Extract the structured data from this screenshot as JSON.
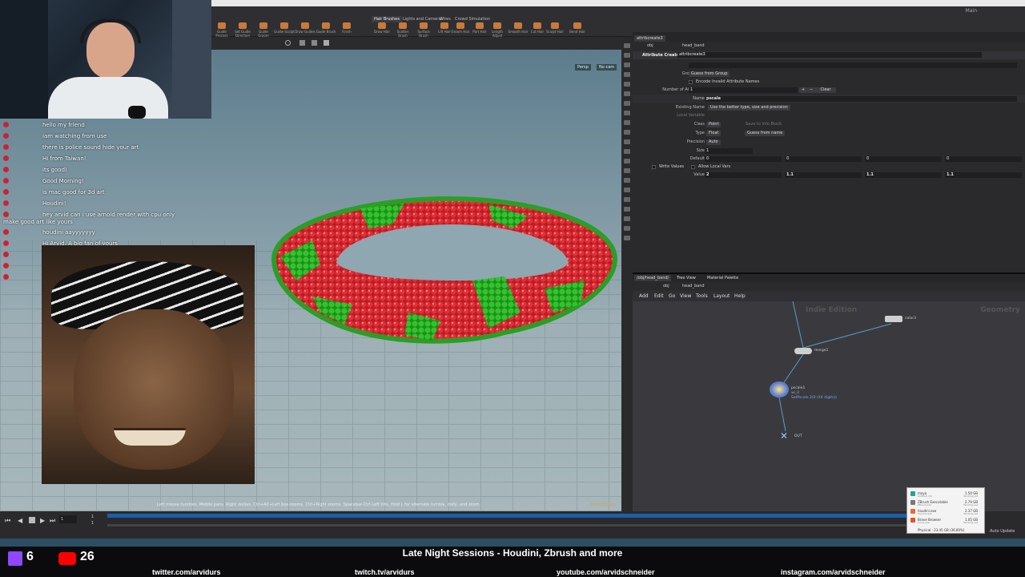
{
  "shelf": {
    "tabs": [
      "Hair Brushes",
      "Lights and Cameras",
      "Wires",
      "Crowd Simulation"
    ],
    "tools": [
      "Guide Process",
      "Set Guide Direction",
      "Guide Groom",
      "Guide Sculpt",
      "Draw Guides",
      "Guide Brush",
      "Finish",
      "Draw Hair",
      "Scatter Brush",
      "Surface Brush",
      "Lift Hair",
      "Groom Hair",
      "Part Hair",
      "Length Adjust",
      "Smooth Hair",
      "Cut Hair",
      "Sculpt Hair",
      "Bend Hair"
    ],
    "workspace": "Main"
  },
  "viewport": {
    "persp": "Persp",
    "cam": "No cam",
    "hint": "Left mouse tumbles. Middle pans. Right dollies. Ctrl+Alt+Left box-zooms. Ctrl+Right zooms. Spacebar-Ctrl-Left tilts. Hold L for alternate tumble, dolly, and zoom.",
    "indie": "Indie Edition"
  },
  "chat": [
    {
      "user": "",
      "msg": "hello my friend"
    },
    {
      "user": "",
      "msg": "iam watching from use"
    },
    {
      "user": "",
      "msg": "there is police sound hide your art"
    },
    {
      "user": "",
      "msg": "Hi from Taiwan!"
    },
    {
      "user": "",
      "msg": "its good)"
    },
    {
      "user": "",
      "msg": "Good Morning!"
    },
    {
      "user": "",
      "msg": "is mac good for 3d art"
    },
    {
      "user": "",
      "msg": "Houdini!"
    },
    {
      "user": "",
      "msg": "hey arvid can i use arnold render with cpu only"
    },
    {
      "user": "",
      "msg": "make good art like yours"
    },
    {
      "user": "",
      "msg": "houdini aayyyyyyy"
    },
    {
      "user": "",
      "msg": "Hi Arvid. A big fan of yours"
    },
    {
      "user": "",
      "msg": "do you ever sleep"
    },
    {
      "user": "",
      "msg": "Ohhh look who it is!"
    },
    {
      "user": "",
      "msg": "The chat is ready to display messages..."
    }
  ],
  "params": {
    "tab": "attribcreate3",
    "path_node": "head_band",
    "path_obj": "obj",
    "node_type": "Attribute Create",
    "node_name": "attribcreate3",
    "group_label": "Group",
    "group_type_label": "Group Type",
    "group_type": "Guess from Group",
    "encode_label": "Encode Invalid Attribute Names",
    "num_attrs_label": "Number of Attributes",
    "num_attrs": "1",
    "clear": "Clear",
    "name_label": "Name",
    "name_value": "pscale",
    "existing_label": "Existing Name",
    "existing_value": "Use the better type, size and precision",
    "local_var_label": "Local Variable",
    "class_label": "Class",
    "class_value": "Point",
    "save_info": "Save to Info Block",
    "type_label": "Type",
    "type_value": "Float",
    "guess_name": "Guess from name",
    "precision_label": "Precision",
    "precision_value": "Auto",
    "size_label": "Size",
    "size_value": "1",
    "default_label": "Default",
    "default_values": [
      "0",
      "0",
      "0",
      "0"
    ],
    "write_label": "Write Values",
    "allow_local": "Allow Local Vars",
    "value_label": "Value",
    "values": [
      "2",
      "1.1",
      "1.1",
      "1.1"
    ]
  },
  "network": {
    "tabs": [
      "/obj/head_band/",
      "Tree View",
      "Material Palette"
    ],
    "path_obj": "obj",
    "path_node": "head_band",
    "menu": [
      "Add",
      "Edit",
      "Go",
      "View",
      "Tools",
      "Layout",
      "Help"
    ],
    "watermark_left": "Indie Edition",
    "watermark_right": "Geometry",
    "nodes": {
      "color": "color3",
      "merge": "merge1",
      "pscale": "pscale1",
      "pscale_sub": "wi_0",
      "pscale_info": "SetPscale 2(0 (X4 digits))",
      "out": "OUT"
    }
  },
  "timeline": {
    "frame": "1",
    "start": "1",
    "end": "1",
    "auto_update": "Auto Update"
  },
  "popup": {
    "rows": [
      {
        "name": "maya",
        "sub": "Untitled.mb",
        "size": "1.50 GB",
        "status": "Working set",
        "color": "#2aa197"
      },
      {
        "name": "ZBrush Executable",
        "sub": "ZBrush.exe",
        "size": "2.79 GB",
        "status": "Working set",
        "color": "#777777"
      },
      {
        "name": "houdini.exe",
        "sub": "Houdini.exe",
        "size": "2.37 GB",
        "status": "Working set",
        "color": "#e66b2c"
      },
      {
        "name": "Brave Browser",
        "sub": "brave.exe",
        "size": "1.05 GB",
        "status": "Working set",
        "color": "#e5532d"
      }
    ],
    "physical": "Physical : 23.45 GB (36.80%)"
  },
  "overlay": {
    "twitch_count": "6",
    "youtube_count": "26",
    "title": "Late Night Sessions - Houdini, Zbrush and more",
    "links": [
      "twitter.com/arvidurs",
      "twitch.tv/arvidurs",
      "youtube.com/arvidschneider",
      "instagram.com/arvidschneider"
    ]
  },
  "colors": {
    "twitch": "#9146ff",
    "youtube": "#ff0000",
    "torus_red": "#d3262b",
    "torus_green": "#2fb52a",
    "timeline_blue": "#1b5fa8"
  }
}
